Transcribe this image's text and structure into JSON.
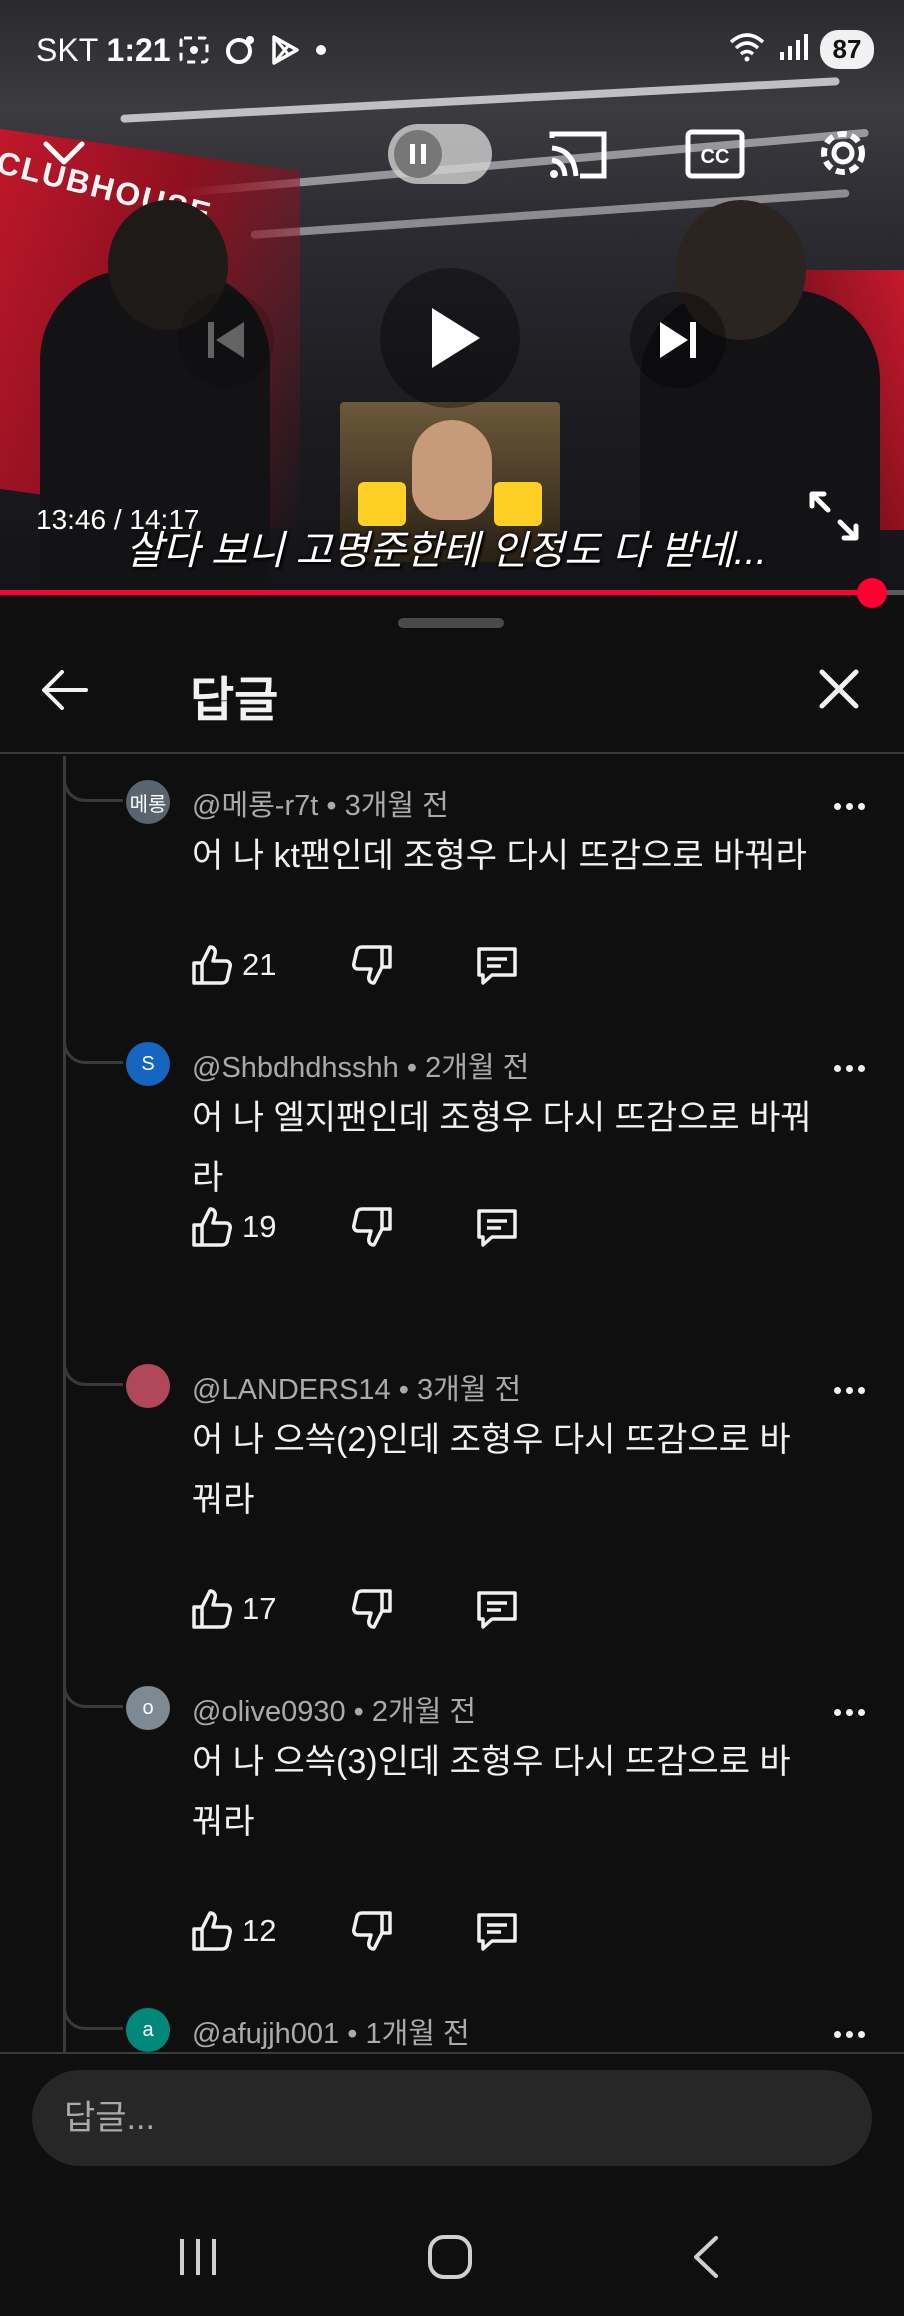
{
  "status_bar": {
    "carrier": "SKT",
    "time": "1:21",
    "icons": [
      "screenshot-icon",
      "camera-icon",
      "play-store-icon",
      "dot-icon"
    ],
    "right_icons": [
      "wifi-icon",
      "signal-icon"
    ],
    "battery": "87"
  },
  "video": {
    "time_readout": "13:46 / 14:17",
    "caption": "살다 보니 고명준한테 인정도 다 받네...",
    "sign_text": "CLUBHOUSE",
    "progress": 0.965,
    "controls": [
      "collapse-icon",
      "autoplay-toggle",
      "cast-icon",
      "cc-icon",
      "settings-icon",
      "previous-icon",
      "play-icon",
      "next-icon",
      "fullscreen-icon"
    ]
  },
  "panel": {
    "title": "답글",
    "back_icon": "arrow-left-icon",
    "close_icon": "close-icon"
  },
  "replies": [
    {
      "author": "@메롱-r7t",
      "age": "3개월 전",
      "text": "어 나 kt팬인데 조형우 다시 뜨감으로 바꿔라",
      "likes": "21",
      "avatar_text": "메롱",
      "avatar_color": "#5a6470"
    },
    {
      "author": "@Shbdhdhsshh",
      "age": "2개월 전",
      "text": "어 나 엘지팬인데 조형우 다시 뜨감으로 바꿔라",
      "likes": "19",
      "avatar_text": "S",
      "avatar_color": "#1565c0"
    },
    {
      "author": "@LANDERS14",
      "age": "3개월 전",
      "text": "어 나 으쓱(2)인데 조형우 다시 뜨감으로 바꿔라",
      "likes": "17",
      "avatar_text": "",
      "avatar_color": "#b0475a"
    },
    {
      "author": "@olive0930",
      "age": "2개월 전",
      "text": "어 나 으쓱(3)인데 조형우 다시 뜨감으로 바꿔라",
      "likes": "12",
      "avatar_text": "o",
      "avatar_color": "#7d8a94"
    },
    {
      "author": "@afujjh001",
      "age": "1개월 전",
      "text": "",
      "likes": "",
      "avatar_text": "a",
      "avatar_color": "#00897b"
    }
  ],
  "reply_input": {
    "placeholder": "답글..."
  },
  "nav": [
    "recent-apps-icon",
    "home-icon",
    "back-icon"
  ]
}
